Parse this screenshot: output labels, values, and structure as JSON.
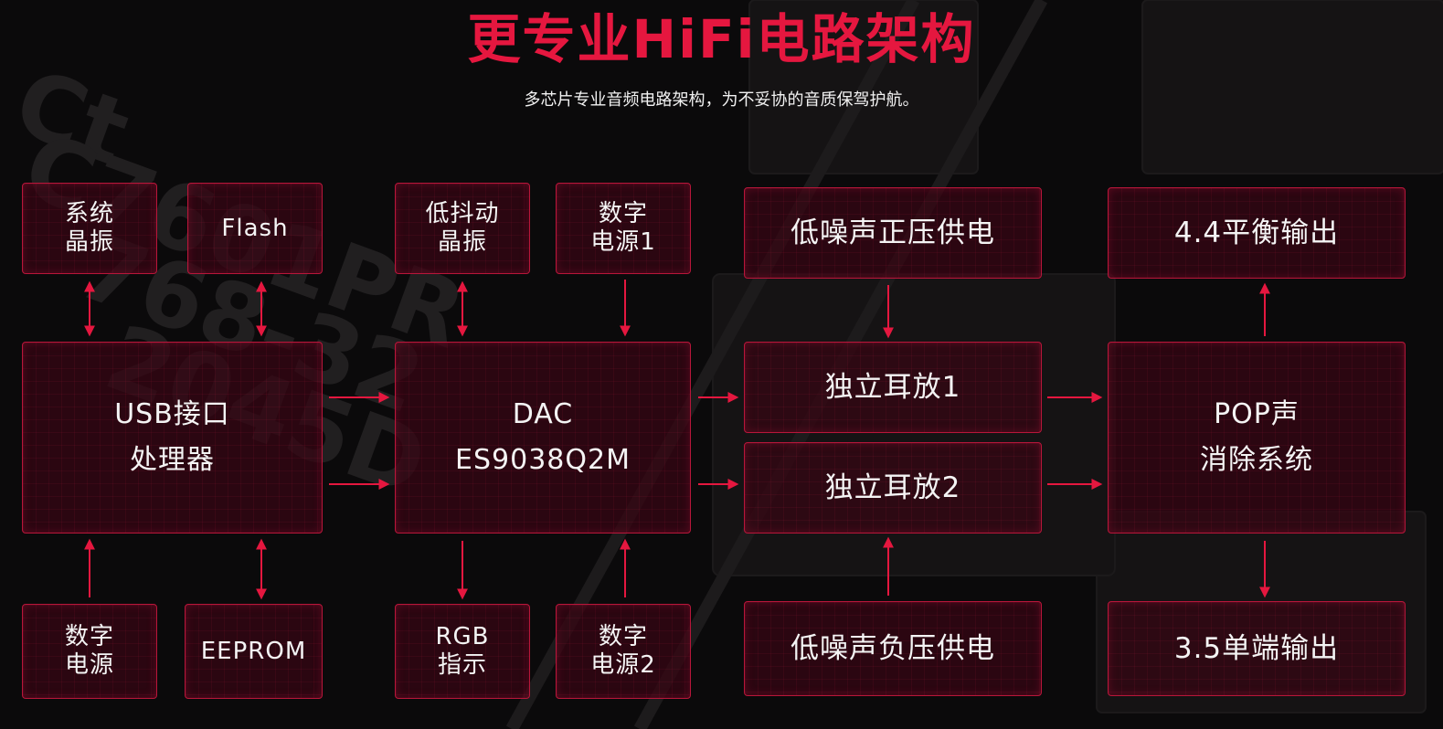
{
  "header": {
    "title": "更专业HiFi电路架构",
    "subtitle": "多芯片专业音频电路架构，为不妥协的音质保驾护航。"
  },
  "background": {
    "watermark_text": [
      "Ct",
      "C7601PR",
      "768-32",
      "2045D"
    ]
  },
  "blocks": {
    "sys_crystal": [
      "系统",
      "晶振"
    ],
    "flash": [
      "Flash"
    ],
    "usb": [
      "USB接口",
      "处理器"
    ],
    "digital_power": [
      "数字",
      "电源"
    ],
    "eeprom": [
      "EEPROM"
    ],
    "low_jitter_crystal": [
      "低抖动",
      "晶振"
    ],
    "digital_power_1": [
      "数字",
      "电源1"
    ],
    "dac": [
      "DAC",
      "ES9038Q2M"
    ],
    "rgb": [
      "RGB",
      "指示"
    ],
    "digital_power_2": [
      "数字",
      "电源2"
    ],
    "positive_power": [
      "低噪声正压供电"
    ],
    "amp_1": [
      "独立耳放1"
    ],
    "amp_2": [
      "独立耳放2"
    ],
    "negative_power": [
      "低噪声负压供电"
    ],
    "balanced_out": [
      "4.4平衡输出"
    ],
    "pop": [
      "POP声",
      "消除系统"
    ],
    "single_out": [
      "3.5单端输出"
    ]
  },
  "colors": {
    "accent": "#e5173f",
    "box_border": "#b8163a",
    "box_fill": "#380614",
    "text": "#f4f4f4",
    "background": "#0b0a0b"
  }
}
